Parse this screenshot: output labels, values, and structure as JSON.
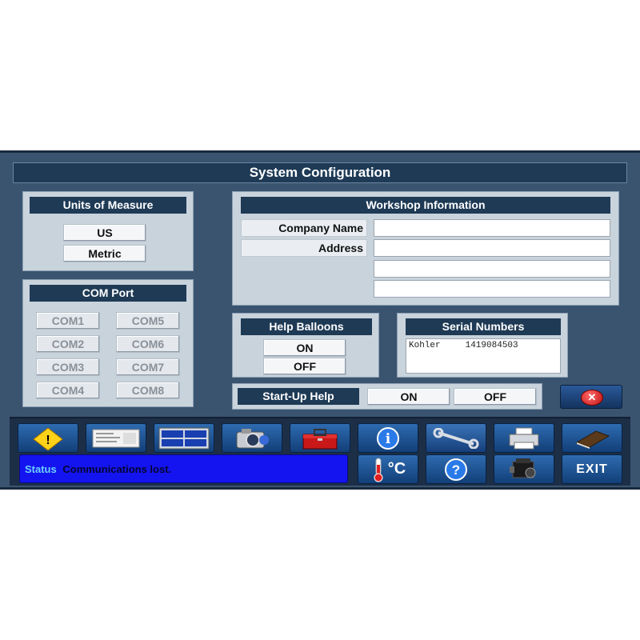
{
  "window": {
    "title": "System Configuration"
  },
  "units": {
    "header": "Units of Measure",
    "options": [
      "US",
      "Metric"
    ]
  },
  "com_port": {
    "header": "COM Port",
    "ports": [
      "COM1",
      "COM5",
      "COM2",
      "COM6",
      "COM3",
      "COM7",
      "COM4",
      "COM8"
    ]
  },
  "workshop": {
    "header": "Workshop Information",
    "company_label": "Company Name",
    "address_label": "Address",
    "company_value": "",
    "address_lines": [
      "",
      "",
      ""
    ]
  },
  "help_balloons": {
    "header": "Help Balloons",
    "on": "ON",
    "off": "OFF"
  },
  "serial_numbers": {
    "header": "Serial Numbers",
    "entries": [
      {
        "name": "Kohler",
        "number": "1419084503"
      }
    ]
  },
  "startup_help": {
    "label": "Start-Up Help",
    "on": "ON",
    "off": "OFF"
  },
  "close_button": {
    "icon": "close-icon"
  },
  "toolbar": {
    "icons": [
      "warning-icon",
      "report-icon",
      "data-monitor-icon",
      "camera-icon",
      "toolbox-icon",
      "info-icon",
      "wrench-icon",
      "printer-icon",
      "book-icon"
    ],
    "bottom_icons": [
      "temperature-unit-icon",
      "help-icon",
      "engine-icon"
    ],
    "temp_label": "°C",
    "exit_label": "EXIT"
  },
  "status": {
    "label": "Status",
    "text": "Communications lost."
  },
  "colors": {
    "window_bg": "#3a5470",
    "header_bg": "#1e3a55",
    "panel_bg": "#c9d3dc",
    "status_bg": "#1414f0",
    "toolbar_button": "#2e6bb0"
  }
}
